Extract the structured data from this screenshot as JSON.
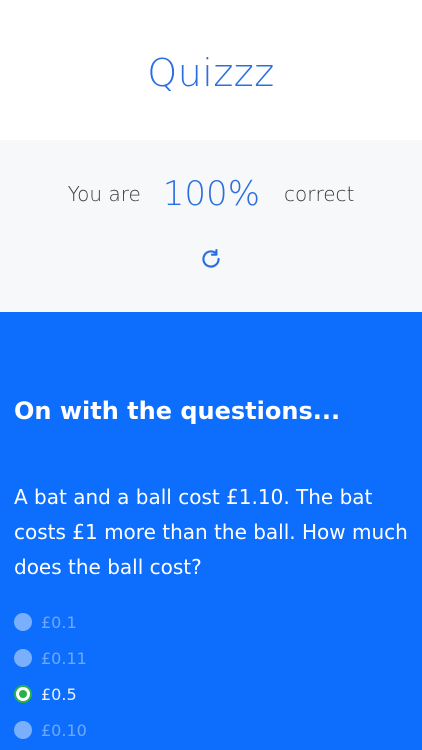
{
  "app": {
    "title": "Quizzz"
  },
  "score": {
    "prefix": "You are",
    "value": "100%",
    "suffix": "correct",
    "reset_icon": "refresh-icon"
  },
  "questions": {
    "heading": "On with the questions...",
    "items": [
      {
        "text": "A bat and a ball cost £1.10. The bat costs £1 more than the ball. How much does the ball cost?",
        "options": [
          {
            "label": "£0.1",
            "selected": false
          },
          {
            "label": "£0.11",
            "selected": false
          },
          {
            "label": "£0.5",
            "selected": true
          },
          {
            "label": "£0.10",
            "selected": false
          }
        ]
      }
    ]
  },
  "colors": {
    "accent": "#2a6fe0",
    "panel": "#0d6efd",
    "score_bg": "#f7f8fa",
    "selected_radio": "#27b34a"
  }
}
